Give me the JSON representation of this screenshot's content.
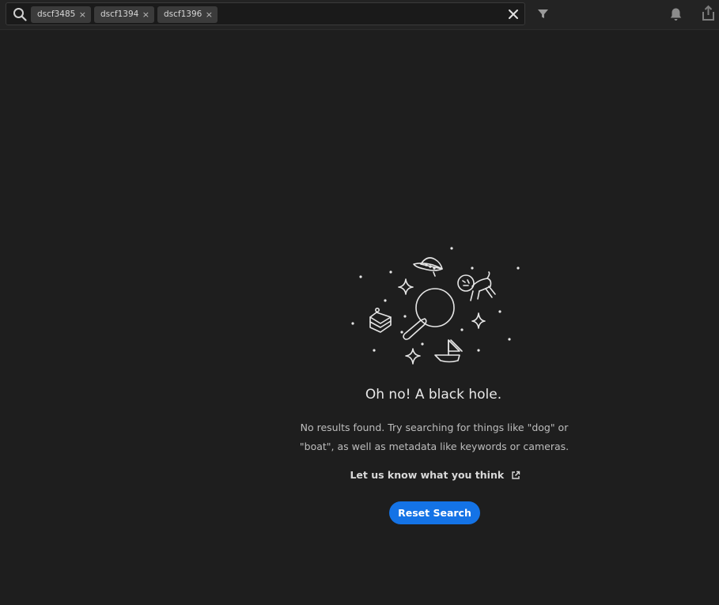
{
  "search": {
    "chips": [
      {
        "label": "dscf3485"
      },
      {
        "label": "dscf1394"
      },
      {
        "label": "dscf1396"
      }
    ],
    "chip_remove_glyph": "×"
  },
  "icons": {
    "search": "search-icon",
    "clear": "close-icon",
    "filter": "filter-icon",
    "notifications": "bell-icon",
    "share": "share-icon"
  },
  "empty_state": {
    "title": "Oh no! A black hole.",
    "description_line1": "No results found. Try searching for things like \"dog\" or",
    "description_line2": "\"boat\", as well as metadata like keywords or cameras.",
    "feedback_link": "Let us know what you think",
    "reset_button": "Reset Search"
  },
  "colors": {
    "background": "#1e1e1e",
    "topbar": "#232323",
    "accent": "#1473e6"
  }
}
